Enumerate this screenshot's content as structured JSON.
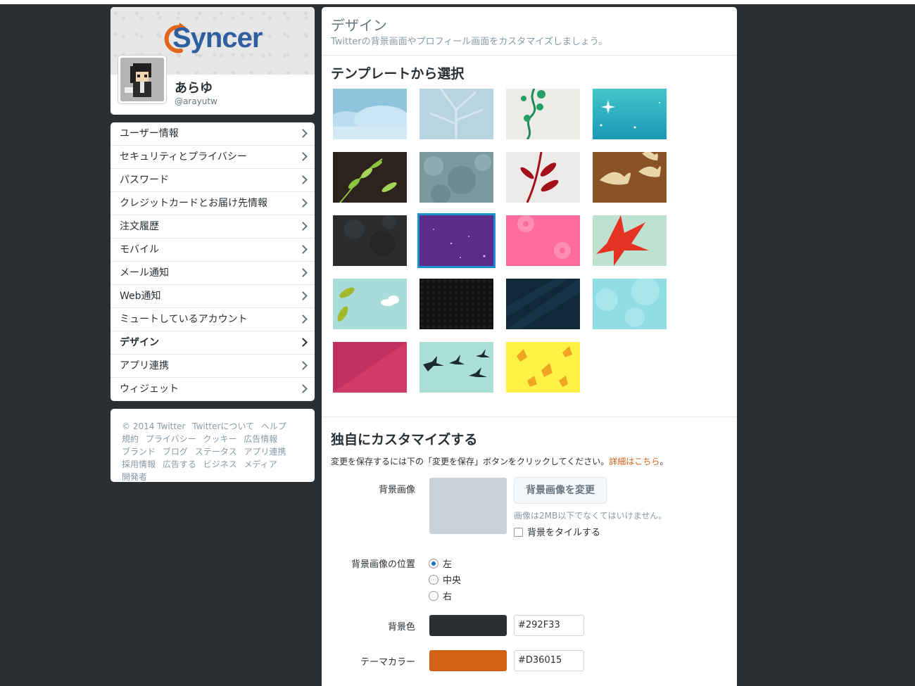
{
  "profile": {
    "logo_text": "Syncer",
    "name": "あらゆ",
    "handle": "@arayutw"
  },
  "sidebar": {
    "items": [
      {
        "label": "ユーザー情報",
        "active": false
      },
      {
        "label": "セキュリティとプライバシー",
        "active": false
      },
      {
        "label": "パスワード",
        "active": false
      },
      {
        "label": "クレジットカードとお届け先情報",
        "active": false
      },
      {
        "label": "注文履歴",
        "active": false
      },
      {
        "label": "モバイル",
        "active": false
      },
      {
        "label": "メール通知",
        "active": false
      },
      {
        "label": "Web通知",
        "active": false
      },
      {
        "label": "ミュートしているアカウント",
        "active": false
      },
      {
        "label": "デザイン",
        "active": true
      },
      {
        "label": "アプリ連携",
        "active": false
      },
      {
        "label": "ウィジェット",
        "active": false
      }
    ]
  },
  "footer": {
    "links": [
      "© 2014 Twitter",
      "Twitterについて",
      "ヘルプ",
      "規約",
      "プライバシー",
      "クッキー",
      "広告情報",
      "ブランド",
      "ブログ",
      "ステータス",
      "アプリ連携",
      "採用情報",
      "広告する",
      "ビジネス",
      "メディア",
      "開発者"
    ]
  },
  "header": {
    "title": "デザイン",
    "subtitle": "Twitterの背景画面やプロフィール画面をカスタマイズしましょう。"
  },
  "templates": {
    "title": "テンプレートから選択",
    "selected_index": 9,
    "count": 19
  },
  "custom": {
    "title": "独自にカスタマイズする",
    "note_prefix": "変更を保存するには下の「変更を保存」ボタンをクリックしてください。",
    "note_link": "詳細はこちら",
    "note_suffix": "。",
    "bg_image_label": "背景画像",
    "change_bg_button": "背景画像を変更",
    "size_hint": "画像は2MB以下でなくてはいけません。",
    "tile_label": "背景をタイルする",
    "tile_checked": false,
    "position_label": "背景画像の位置",
    "positions": [
      "左",
      "中央",
      "右"
    ],
    "position_selected": "左",
    "bg_color_label": "背景色",
    "bg_color": "#292F33",
    "theme_color_label": "テーマカラー",
    "theme_color": "#D36015"
  }
}
